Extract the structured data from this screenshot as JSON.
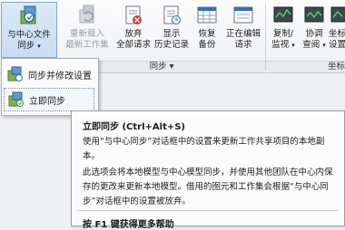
{
  "ribbon": {
    "buttons": [
      {
        "line1": "与中心文件",
        "line2": "同步",
        "caret": "▾"
      },
      {
        "line1": "重新载入",
        "line2": "最新工作集"
      },
      {
        "line1": "放弃",
        "line2": "全部请求"
      },
      {
        "line1": "显示",
        "line2": "历史记录"
      },
      {
        "line1": "恢复",
        "line2": "备份"
      },
      {
        "line1": "正在编辑",
        "line2": "请求"
      },
      {
        "line1": "复制/",
        "line2": "监视",
        "caret": "▾"
      },
      {
        "line1": "协调",
        "line2": "查阅",
        "caret": "▾"
      },
      {
        "line1": "坐标",
        "line2": "设置"
      }
    ],
    "panel_label": "同步 ▾",
    "panel_label_right": "坐标"
  },
  "menu": {
    "items": [
      {
        "label": "同步并修改设置"
      },
      {
        "label": "立即同步"
      }
    ]
  },
  "tooltip": {
    "title": "立即同步 (Ctrl+Alt+S)",
    "para1": "使用“与中心同步”对话框中的设置来更新工作共享项目的本地副本。",
    "para2": "此选项会将本地模型与中心模型同步，并使用其他团队在中心内保存的更改来更新本地模型。借用的图元和工作集会根据“与中心同步”对话框中的设置被放弃。",
    "help": "按 F1 键获得更多帮助"
  },
  "colors": {
    "accent_blue": "#2f6fbf",
    "red_x": "#d43a2f",
    "green": "#3a9a3a"
  }
}
